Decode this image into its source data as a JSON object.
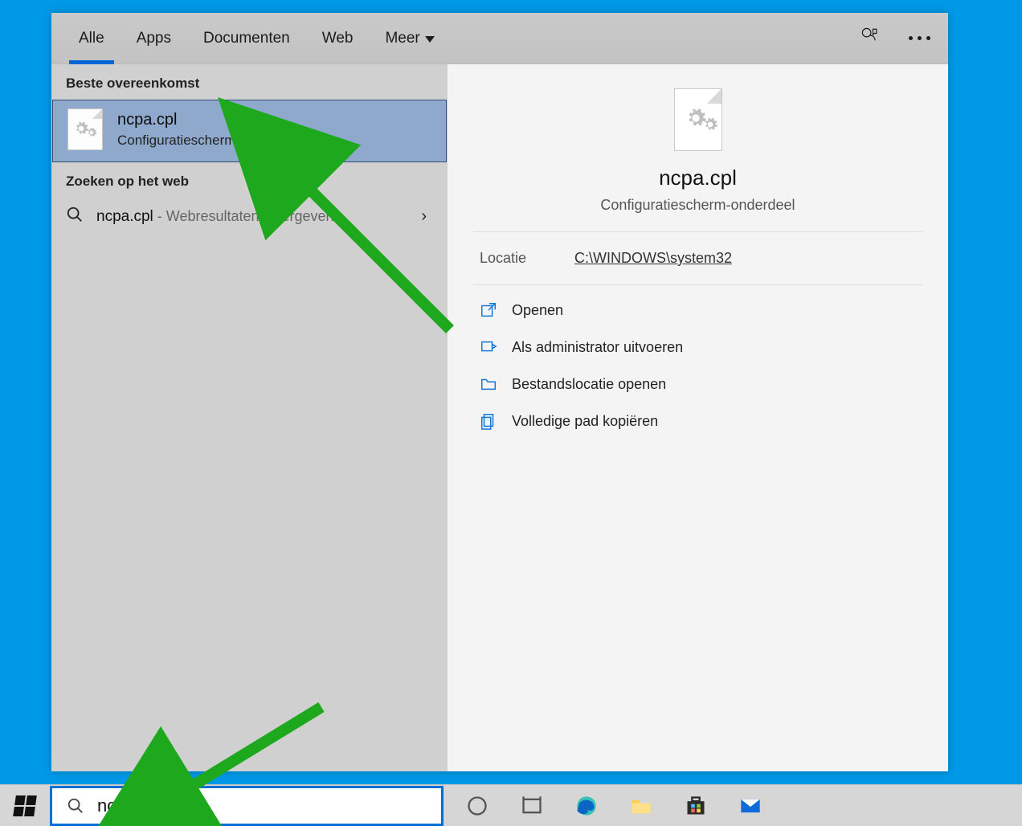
{
  "tabs": {
    "all": "Alle",
    "apps": "Apps",
    "documents": "Documenten",
    "web": "Web",
    "more": "Meer"
  },
  "left": {
    "best_match_label": "Beste overeenkomst",
    "best_title": "ncpa.cpl",
    "best_subtitle": "Configuratiescherm-onderdeel",
    "web_label": "Zoeken op het web",
    "web_query": "ncpa.cpl",
    "web_suffix": " - Webresultaten weergeven"
  },
  "preview": {
    "title": "ncpa.cpl",
    "subtitle": "Configuratiescherm-onderdeel",
    "location_label": "Locatie",
    "location_value": "C:\\WINDOWS\\system32",
    "actions": {
      "open": "Openen",
      "run_admin": "Als administrator uitvoeren",
      "open_location": "Bestandslocatie openen",
      "copy_path": "Volledige pad kopiëren"
    }
  },
  "taskbar": {
    "query": "ncpa.cpl"
  }
}
